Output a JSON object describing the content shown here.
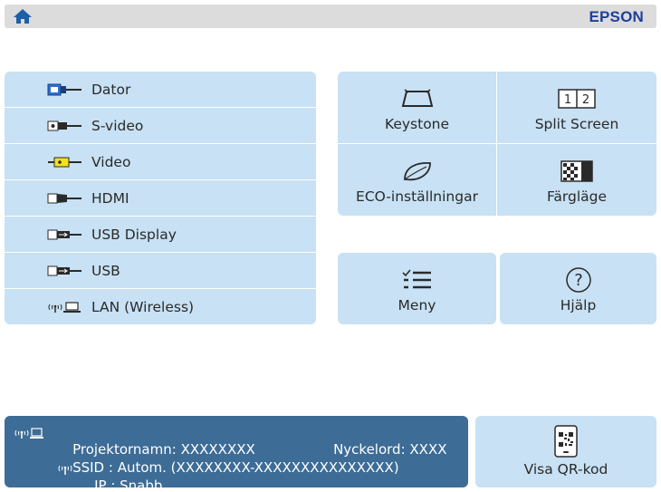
{
  "header": {
    "brand": "EPSON",
    "home_icon": "home-icon"
  },
  "sources": [
    {
      "label": "Dator",
      "icon": "computer-vga-connector-icon"
    },
    {
      "label": "S-video",
      "icon": "s-video-connector-icon"
    },
    {
      "label": "Video",
      "icon": "video-rca-connector-icon"
    },
    {
      "label": "HDMI",
      "icon": "hdmi-connector-icon"
    },
    {
      "label": "USB Display",
      "icon": "usb-display-connector-icon"
    },
    {
      "label": "USB",
      "icon": "usb-connector-icon"
    },
    {
      "label": "LAN (Wireless)",
      "icon": "wireless-lan-icon"
    }
  ],
  "tiles": {
    "keystone": "Keystone",
    "split_screen": "Split Screen",
    "split_screen_icon_text": [
      "1",
      "2"
    ],
    "eco": "ECO-inställningar",
    "color_mode": "Färgläge",
    "menu": "Meny",
    "help": "Hjälp",
    "help_glyph": "?"
  },
  "network": {
    "projector_name_label": "Projektornamn",
    "projector_name_value": "XXXXXXXX",
    "keyword_label": "Nyckelord",
    "keyword_value": "XXXX",
    "ssid_label": "SSID",
    "ssid_value": "Autom. (XXXXXXXX-XXXXXXXXXXXXXXX)",
    "ip_label": "IP",
    "ip_value": "Snabb"
  },
  "qr": {
    "label": "Visa QR-kod"
  },
  "colors": {
    "tile_bg": "#c8e1f4",
    "info_bg": "#3d6c96",
    "brand": "#1f3f9c",
    "header_bg": "#dcdcdc"
  }
}
